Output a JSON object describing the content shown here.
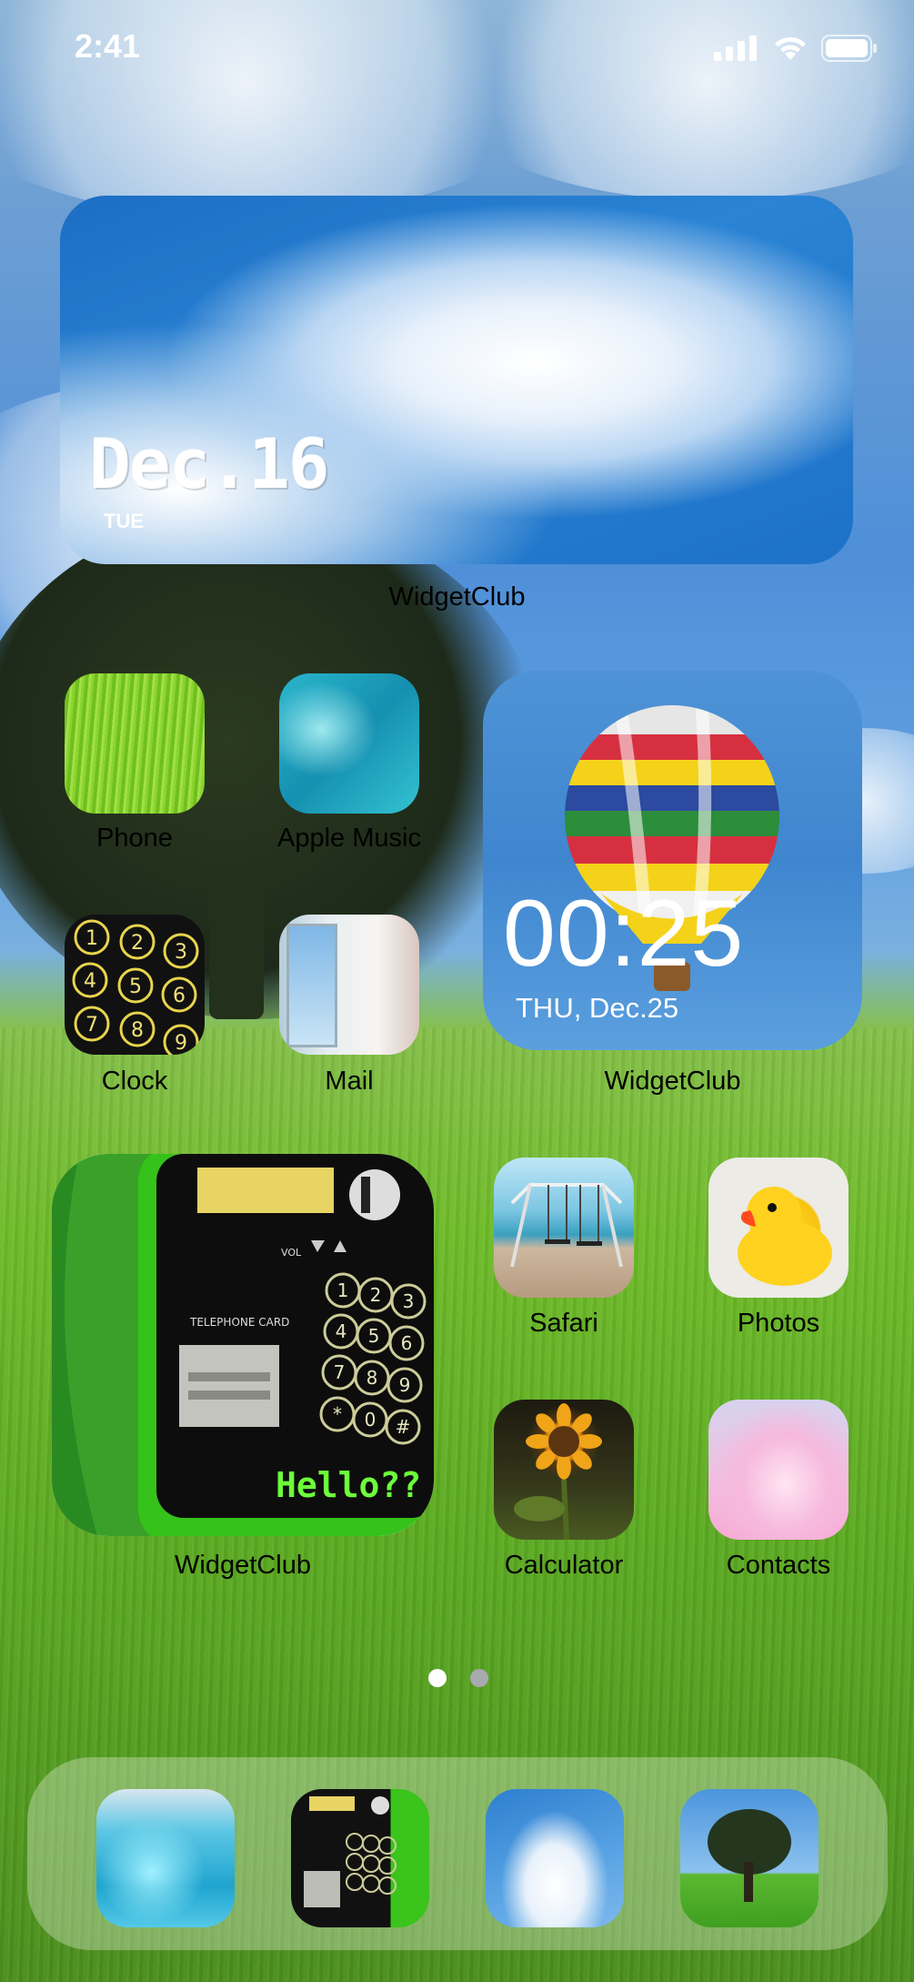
{
  "status": {
    "time": "2:41"
  },
  "icons": {
    "signal": "cellular-signal-icon",
    "wifi": "wifi-icon",
    "battery": "battery-icon"
  },
  "widget_date": {
    "date": "Dec.16",
    "day": "TUE",
    "label": "WidgetClub"
  },
  "apps_row1": [
    {
      "label": "Phone"
    },
    {
      "label": "Apple Music"
    }
  ],
  "apps_row2": [
    {
      "label": "Clock"
    },
    {
      "label": "Mail"
    }
  ],
  "widget_clock": {
    "time": "00:25",
    "date": "THU, Dec.25",
    "label": "WidgetClub"
  },
  "widget_phone": {
    "label": "WidgetClub",
    "text": "Hello??",
    "card_text": "TELEPHONE CARD",
    "vol_text": "VOL"
  },
  "apps_row3": [
    {
      "label": "Safari"
    },
    {
      "label": "Photos"
    }
  ],
  "apps_row4": [
    {
      "label": "Calculator"
    },
    {
      "label": "Contacts"
    }
  ],
  "page_indicator": {
    "current": 1,
    "total": 2
  },
  "colors": {
    "label": "#000000",
    "white": "#ffffff",
    "dot_active": "#ffffff",
    "dot_inactive": "#9aa0a6"
  }
}
